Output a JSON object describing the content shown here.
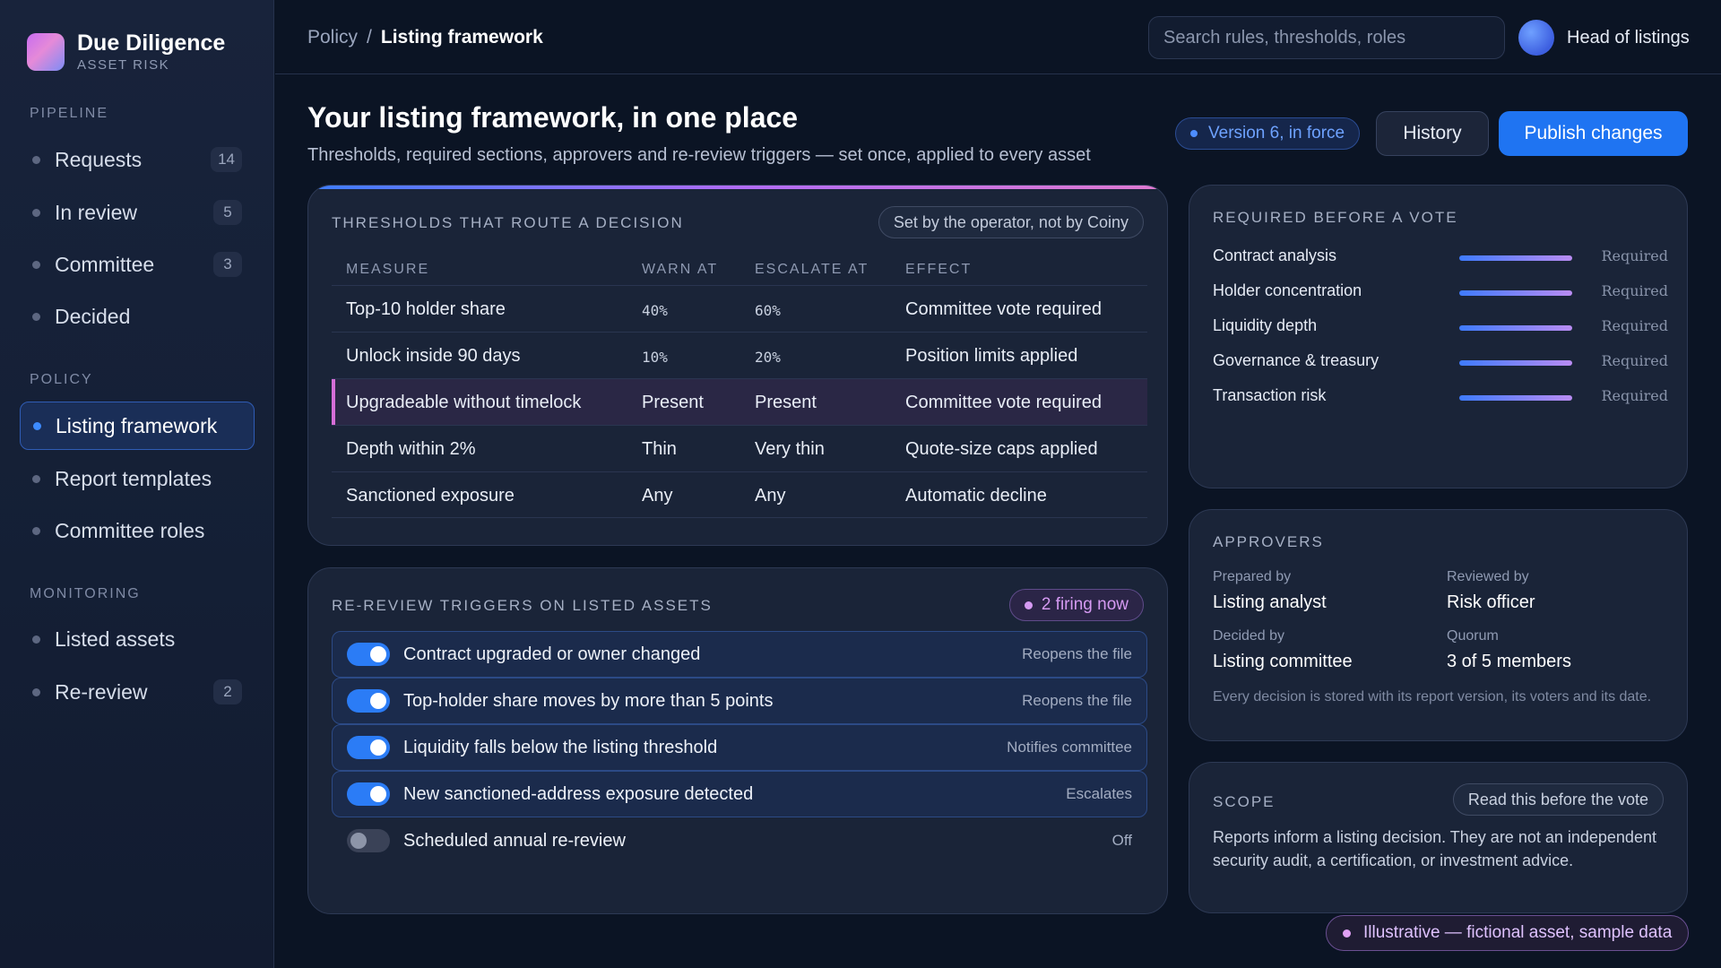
{
  "brand": {
    "title": "Due Diligence",
    "subtitle": "ASSET RISK"
  },
  "sidebar": {
    "sections": [
      {
        "title": "PIPELINE",
        "items": [
          {
            "label": "Requests",
            "count": "14"
          },
          {
            "label": "In review",
            "count": "5"
          },
          {
            "label": "Committee",
            "count": "3"
          },
          {
            "label": "Decided",
            "count": ""
          }
        ]
      },
      {
        "title": "POLICY",
        "items": [
          {
            "label": "Listing framework",
            "count": "",
            "active": true
          },
          {
            "label": "Report templates",
            "count": ""
          },
          {
            "label": "Committee roles",
            "count": ""
          }
        ]
      },
      {
        "title": "MONITORING",
        "items": [
          {
            "label": "Listed assets",
            "count": ""
          },
          {
            "label": "Re-review",
            "count": "2"
          }
        ]
      }
    ]
  },
  "header": {
    "breadcrumb": {
      "parent": "Policy",
      "separator": "/",
      "current": "Listing framework"
    },
    "search_placeholder": "Search rules, thresholds, roles",
    "user_name": "Head of listings"
  },
  "page": {
    "title": "Your listing framework, in one place",
    "subtitle": "Thresholds, required sections, approvers and re-review triggers — set once, applied to every asset",
    "version_badge": "Version 6, in force",
    "history_label": "History",
    "publish_label": "Publish changes"
  },
  "thresholds": {
    "heading": "THRESHOLDS THAT ROUTE A DECISION",
    "note": "Set by the operator, not by Coiny",
    "columns": [
      "MEASURE",
      "WARN AT",
      "ESCALATE AT",
      "EFFECT"
    ],
    "rows": [
      {
        "measure": "Top-10 holder share",
        "warn": "40%",
        "escalate": "60%",
        "effect": "Committee vote required",
        "mono": true
      },
      {
        "measure": "Unlock inside 90 days",
        "warn": "10%",
        "escalate": "20%",
        "effect": "Position limits applied",
        "mono": true
      },
      {
        "measure": "Upgradeable without timelock",
        "warn": "Present",
        "escalate": "Present",
        "effect": "Committee vote required",
        "highlight": true
      },
      {
        "measure": "Depth within 2%",
        "warn": "Thin",
        "escalate": "Very thin",
        "effect": "Quote-size caps applied"
      },
      {
        "measure": "Sanctioned exposure",
        "warn": "Any",
        "escalate": "Any",
        "effect": "Automatic decline"
      }
    ]
  },
  "triggers": {
    "heading": "RE-REVIEW TRIGGERS ON LISTED ASSETS",
    "firing": "2 firing now",
    "items": [
      {
        "label": "Contract upgraded or owner changed",
        "effect": "Reopens the file",
        "on": true
      },
      {
        "label": "Top-holder share moves by more than 5 points",
        "effect": "Reopens the file",
        "on": true
      },
      {
        "label": "Liquidity falls below the listing threshold",
        "effect": "Notifies committee",
        "on": true
      },
      {
        "label": "New sanctioned-address exposure detected",
        "effect": "Escalates",
        "on": true
      },
      {
        "label": "Scheduled annual re-review",
        "effect": "Off",
        "on": false
      }
    ]
  },
  "required": {
    "heading": "REQUIRED BEFORE A VOTE",
    "items": [
      {
        "label": "Contract analysis",
        "status": "Required",
        "fill": 1.0
      },
      {
        "label": "Holder concentration",
        "status": "Required",
        "fill": 1.0
      },
      {
        "label": "Liquidity depth",
        "status": "Required",
        "fill": 1.0
      },
      {
        "label": "Governance & treasury",
        "status": "Required",
        "fill": 1.0
      },
      {
        "label": "Transaction risk",
        "status": "Required",
        "fill": 1.0
      }
    ]
  },
  "approvers": {
    "heading": "APPROVERS",
    "prepared_by_label": "Prepared by",
    "prepared_by": "Listing analyst",
    "reviewed_by_label": "Reviewed by",
    "reviewed_by": "Risk officer",
    "decided_by_label": "Decided by",
    "decided_by": "Listing committee",
    "quorum_label": "Quorum",
    "quorum": "3 of 5 members",
    "note": "Every decision is stored with its report version, its voters and its date."
  },
  "scope": {
    "heading": "SCOPE",
    "button": "Read this before the vote",
    "text": "Reports inform a listing decision. They are not an independent security audit, a certification, or investment advice."
  },
  "footer": {
    "disclaimer": "Illustrative — fictional asset, sample data"
  },
  "colors": {
    "accent": "#1f74f2",
    "highlight": "#d56ed8",
    "background": "#0b1424"
  }
}
